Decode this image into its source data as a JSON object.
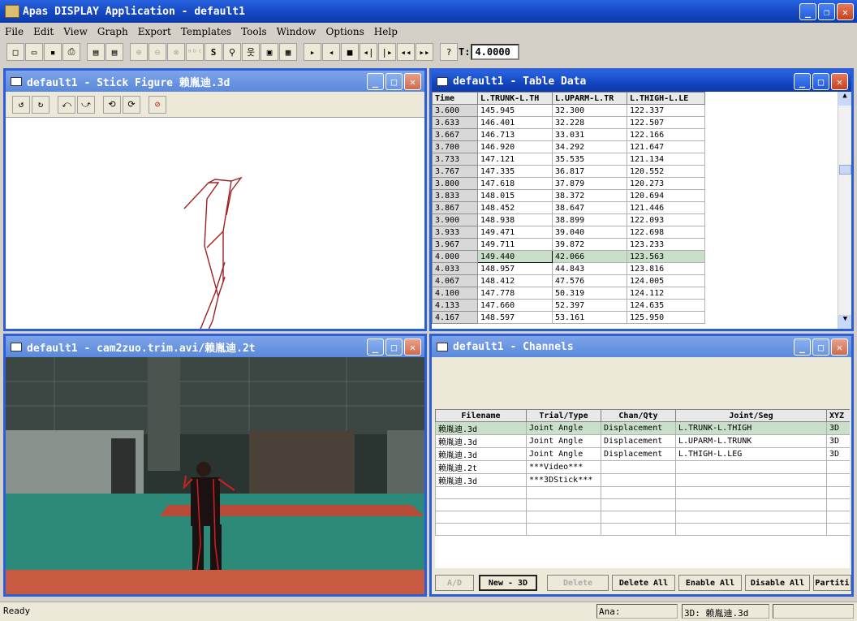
{
  "app": {
    "title": "Apas DISPLAY Application - default1"
  },
  "menu": [
    "File",
    "Edit",
    "View",
    "Graph",
    "Export",
    "Templates",
    "Tools",
    "Window",
    "Options",
    "Help"
  ],
  "toolbar": {
    "t_label": "T:",
    "t_value": "4.0000"
  },
  "stick": {
    "title": "default1 - Stick Figure  赖胤迪.3d"
  },
  "table": {
    "title": "default1 - Table Data",
    "headers": [
      "Time",
      "L.TRUNK-L.TH",
      "L.UPARM-L.TR",
      "L.THIGH-L.LE"
    ],
    "rows": [
      [
        "3.600",
        "145.945",
        "32.300",
        "122.337"
      ],
      [
        "3.633",
        "146.401",
        "32.228",
        "122.507"
      ],
      [
        "3.667",
        "146.713",
        "33.031",
        "122.166"
      ],
      [
        "3.700",
        "146.920",
        "34.292",
        "121.647"
      ],
      [
        "3.733",
        "147.121",
        "35.535",
        "121.134"
      ],
      [
        "3.767",
        "147.335",
        "36.817",
        "120.552"
      ],
      [
        "3.800",
        "147.618",
        "37.879",
        "120.273"
      ],
      [
        "3.833",
        "148.015",
        "38.372",
        "120.694"
      ],
      [
        "3.867",
        "148.452",
        "38.647",
        "121.446"
      ],
      [
        "3.900",
        "148.938",
        "38.899",
        "122.093"
      ],
      [
        "3.933",
        "149.471",
        "39.040",
        "122.698"
      ],
      [
        "3.967",
        "149.711",
        "39.872",
        "123.233"
      ],
      [
        "4.000",
        "149.440",
        "42.066",
        "123.563"
      ],
      [
        "4.033",
        "148.957",
        "44.843",
        "123.816"
      ],
      [
        "4.067",
        "148.412",
        "47.576",
        "124.005"
      ],
      [
        "4.100",
        "147.778",
        "50.319",
        "124.112"
      ],
      [
        "4.133",
        "147.660",
        "52.397",
        "124.635"
      ],
      [
        "4.167",
        "148.597",
        "53.161",
        "125.950"
      ]
    ]
  },
  "video": {
    "title": "default1 - cam2zuo.trim.avi/赖胤迪.2t"
  },
  "channels": {
    "title": "default1 - Channels",
    "headers": [
      "Filename",
      "Trial/Type",
      "Chan/Qty",
      "Joint/Seg",
      "XYZ"
    ],
    "rows": [
      [
        "赖胤迪.3d",
        "Joint Angle",
        "Displacement",
        "L.TRUNK-L.THIGH",
        "3D"
      ],
      [
        "赖胤迪.3d",
        "Joint Angle",
        "Displacement",
        "L.UPARM-L.TRUNK",
        "3D"
      ],
      [
        "赖胤迪.3d",
        "Joint Angle",
        "Displacement",
        "L.THIGH-L.LEG",
        "3D"
      ],
      [
        "赖胤迪.2t",
        "***Video***",
        "",
        "",
        ""
      ],
      [
        "赖胤迪.3d",
        "***3DStick***",
        "",
        "",
        ""
      ]
    ],
    "buttons": [
      "A/D",
      "New - 3D",
      "Delete",
      "Delete All",
      "Enable All",
      "Disable All",
      "Partiti"
    ]
  },
  "status": {
    "left": "Ready",
    "ana": "Ana:",
    "file": "3D: 赖胤迪.3d"
  }
}
